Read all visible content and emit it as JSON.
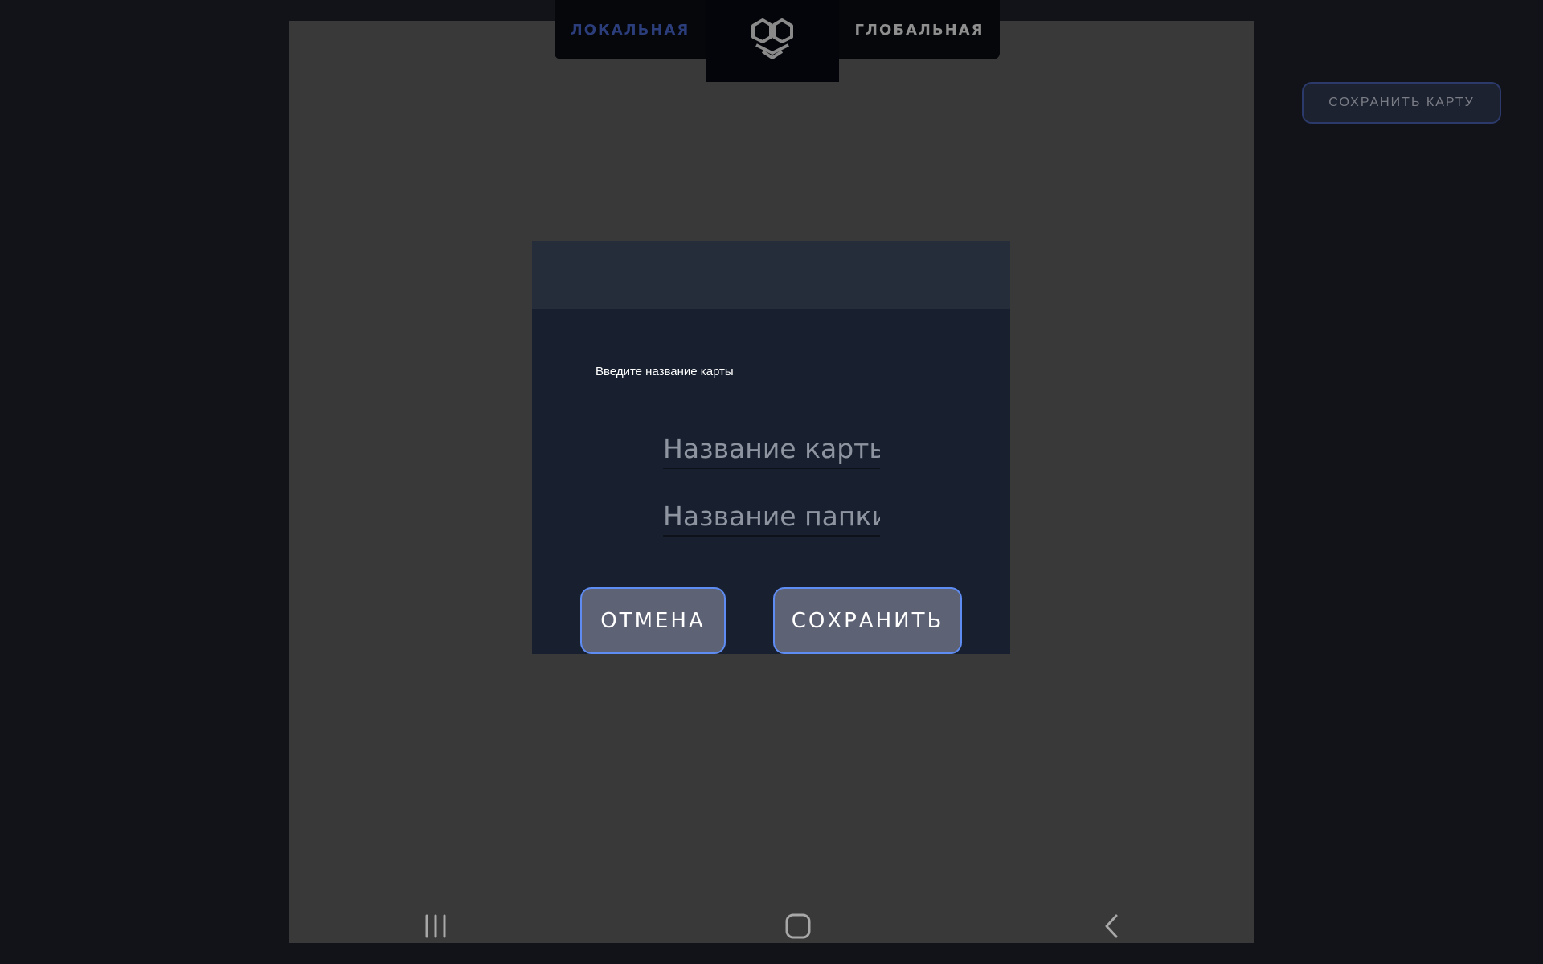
{
  "tabs": {
    "local_label": "ЛОКАЛЬНАЯ",
    "global_label": "ГЛОБАЛЬНАЯ",
    "active": "local"
  },
  "logo": {
    "icon": "app-logo-icon"
  },
  "toolbar": {
    "save_map_label": "СОХРАНИТЬ КАРТУ"
  },
  "dialog": {
    "prompt": "Введите название карты",
    "map_name": {
      "value": "",
      "placeholder": "Название карты"
    },
    "folder_name": {
      "value": "",
      "placeholder": "Название папки"
    },
    "cancel_label": "ОТМЕНА",
    "save_label": "СОХРАНИТЬ"
  },
  "nav": {
    "recent_icon": "recent-apps-icon",
    "home_icon": "home-icon",
    "back_icon": "back-icon"
  },
  "colors": {
    "background": "#111319",
    "map_area": "#393939",
    "dialog_bg": "#182030",
    "dialog_header": "#252c3a",
    "button_fill": "#5d6275",
    "button_border": "#5e8cf2",
    "active_tab": "#2b3d7a",
    "inactive_tab": "#8f8f8f"
  }
}
